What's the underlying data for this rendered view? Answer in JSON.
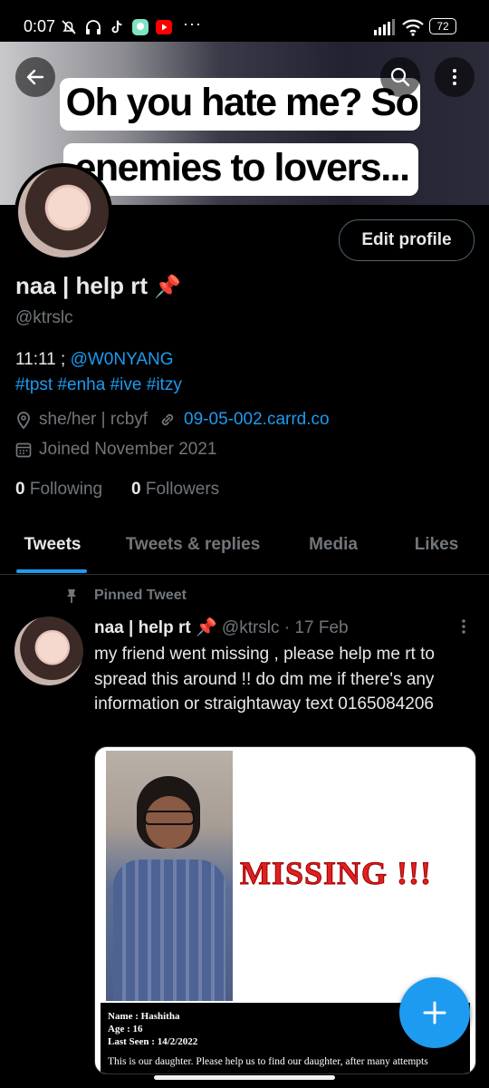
{
  "status_bar": {
    "time": "0:07",
    "battery": "72",
    "more": "···"
  },
  "banner": {
    "caption_line1": "Oh you hate me? So",
    "caption_line2": "enemies to lovers..."
  },
  "profile": {
    "edit_button": "Edit profile",
    "name": "naa | help rt",
    "name_emoji": "📌",
    "handle": "@ktrslc",
    "bio_line1_prefix": "11:11 ; ",
    "bio_mention": "@W0NYANG",
    "hashtags": [
      "#tpst",
      "#enha",
      "#ive",
      "#itzy"
    ],
    "pronouns": "she/her | rcbyf",
    "website": "09-05-002.carrd.co",
    "joined": "Joined November 2021",
    "following_count": "0",
    "following_label": "Following",
    "followers_count": "0",
    "followers_label": "Followers"
  },
  "tabs": [
    {
      "label": "Tweets",
      "active": true
    },
    {
      "label": "Tweets & replies",
      "active": false
    },
    {
      "label": "Media",
      "active": false
    },
    {
      "label": "Likes",
      "active": false
    }
  ],
  "pinned_tweet": {
    "pinned_label": "Pinned Tweet",
    "author_name": "naa | help rt",
    "author_emoji": "📌",
    "author_handle": "@ktrslc",
    "separator": "·",
    "date": "17 Feb",
    "text": "my friend went missing , please help me rt to spread this around !! do dm me if there's any information or straightaway text 0165084206",
    "media": {
      "headline": "MISSING !!!",
      "name_line": "Name : Hashitha",
      "age_line": "Age : 16",
      "last_seen_line": "Last Seen : 14/2/2022",
      "description": "This is our daughter. Please help us to find our daughter, after many attempts"
    }
  },
  "colors": {
    "accent": "#1d9bf0",
    "background": "#000000",
    "secondary_text": "#71767b",
    "missing_red": "#e02020"
  },
  "icons": {
    "back": "arrow-left-icon",
    "search": "search-icon",
    "overflow": "more-vertical-icon",
    "location": "location-pin-icon",
    "link": "link-icon",
    "calendar": "calendar-icon",
    "pin": "pin-icon",
    "compose": "plus-icon"
  }
}
